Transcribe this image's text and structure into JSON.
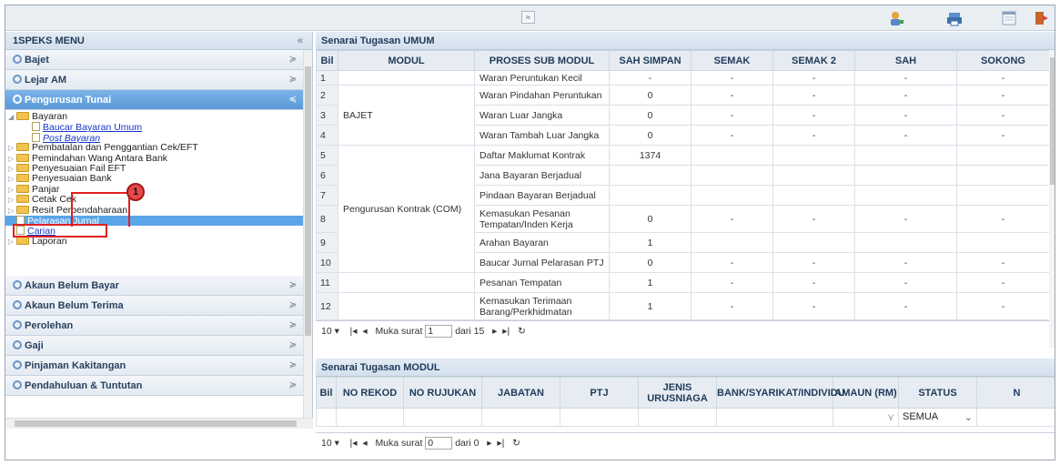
{
  "topbar": {
    "collapse_glyph": "≈"
  },
  "menu": {
    "title": "1SPEKS MENU",
    "collapse_glyph": "«",
    "sections_top": [
      {
        "label": "Bajet"
      },
      {
        "label": "Lejar AM"
      },
      {
        "label": "Pengurusan Tunai",
        "active": true
      }
    ],
    "tree": [
      {
        "label": "Bayaran",
        "type": "folder",
        "expanded": true,
        "level": 0
      },
      {
        "label": "Baucar Bayaran Umum",
        "type": "doc",
        "link": true,
        "level": 2
      },
      {
        "label": "Post Bayaran",
        "type": "doc",
        "link": true,
        "italic": true,
        "level": 2
      },
      {
        "label": "Pembatalan dan Penggantian Cek/EFT",
        "type": "folder",
        "level": 0
      },
      {
        "label": "Pemindahan Wang Antara Bank",
        "type": "folder",
        "level": 0
      },
      {
        "label": "Penyesuaian Fail EFT",
        "type": "folder",
        "level": 0
      },
      {
        "label": "Penyesuaian Bank",
        "type": "folder",
        "level": 0
      },
      {
        "label": "Panjar",
        "type": "folder",
        "level": 0
      },
      {
        "label": "Cetak Cek",
        "type": "folder",
        "level": 0
      },
      {
        "label": "Resit Perbendaharaan",
        "type": "folder",
        "level": 0
      },
      {
        "label": "Pelarasan Jurnal",
        "type": "doc",
        "link": true,
        "selected": true,
        "level": 1
      },
      {
        "label": "Carian",
        "type": "doc",
        "link": true,
        "level": 1
      },
      {
        "label": "Laporan",
        "type": "folder",
        "level": 0
      }
    ],
    "sections_bottom": [
      {
        "label": "Akaun Belum Bayar"
      },
      {
        "label": "Akaun Belum Terima"
      },
      {
        "label": "Perolehan"
      },
      {
        "label": "Gaji"
      },
      {
        "label": "Pinjaman Kakitangan"
      },
      {
        "label": "Pendahuluan & Tuntutan"
      }
    ],
    "callout_number": "1"
  },
  "umum": {
    "title": "Senarai Tugasan UMUM",
    "columns": [
      "Bil",
      "MODUL",
      "PROSES SUB MODUL",
      "SAH SIMPAN",
      "SEMAK",
      "SEMAK 2",
      "SAH",
      "SOKONG"
    ],
    "rows": [
      {
        "bil": "1",
        "proses": "Waran Peruntukan Kecil",
        "sah_simpan": "-",
        "semak": "-",
        "semak2": "-",
        "sah": "-",
        "sokong": "-"
      },
      {
        "bil": "2",
        "proses": "Waran Pindahan Peruntukan",
        "sah_simpan": "0",
        "semak": "-",
        "semak2": "-",
        "sah": "-",
        "sokong": "-"
      },
      {
        "bil": "3",
        "proses": "Waran Luar Jangka",
        "sah_simpan": "0",
        "semak": "-",
        "semak2": "-",
        "sah": "-",
        "sokong": "-"
      },
      {
        "bil": "4",
        "proses": "Waran Tambah Luar Jangka",
        "sah_simpan": "0",
        "semak": "-",
        "semak2": "-",
        "sah": "-",
        "sokong": "-"
      },
      {
        "bil": "5",
        "proses": "Daftar Maklumat Kontrak",
        "sah_simpan": "1374",
        "semak": "",
        "semak2": "",
        "sah": "",
        "sokong": ""
      },
      {
        "bil": "6",
        "proses": "Jana Bayaran Berjadual",
        "sah_simpan": "",
        "semak": "",
        "semak2": "",
        "sah": "",
        "sokong": ""
      },
      {
        "bil": "7",
        "proses": "Pindaan Bayaran Berjadual",
        "sah_simpan": "",
        "semak": "",
        "semak2": "",
        "sah": "",
        "sokong": ""
      },
      {
        "bil": "8",
        "proses": "Kemasukan Pesanan Tempatan/Inden Kerja",
        "sah_simpan": "0",
        "semak": "-",
        "semak2": "-",
        "sah": "-",
        "sokong": "-"
      },
      {
        "bil": "9",
        "proses": "Arahan Bayaran",
        "sah_simpan": "1",
        "semak": "",
        "semak2": "",
        "sah": "",
        "sokong": ""
      },
      {
        "bil": "10",
        "proses": "Baucar Jurnal Pelarasan PTJ",
        "sah_simpan": "0",
        "semak": "-",
        "semak2": "-",
        "sah": "-",
        "sokong": "-"
      },
      {
        "bil": "11",
        "proses": "Pesanan Tempatan",
        "sah_simpan": "1",
        "semak": "-",
        "semak2": "-",
        "sah": "-",
        "sokong": "-"
      },
      {
        "bil": "12",
        "proses": "Kemasukan Terimaan Barang/Perkhidmatan",
        "sah_simpan": "1",
        "semak": "-",
        "semak2": "-",
        "sah": "-",
        "sokong": "-"
      }
    ],
    "modul_bajet": "BAJET",
    "modul_kontrak": "Pengurusan Kontrak (COM)",
    "pager": {
      "page_size": "10",
      "label": "Muka surat",
      "page": "1",
      "of": "dari 15"
    }
  },
  "modul": {
    "title": "Senarai Tugasan MODUL",
    "columns": [
      "Bil",
      "NO REKOD",
      "NO RUJUKAN",
      "JABATAN",
      "PTJ",
      "JENIS URUSNIAGA",
      "BANK/SYARIKAT/INDIVIDU",
      "AMAUN (RM)",
      "STATUS",
      "N"
    ],
    "status_filter": "SEMUA",
    "pager": {
      "page_size": "10",
      "label": "Muka surat",
      "page": "0",
      "of": "dari 0"
    }
  }
}
